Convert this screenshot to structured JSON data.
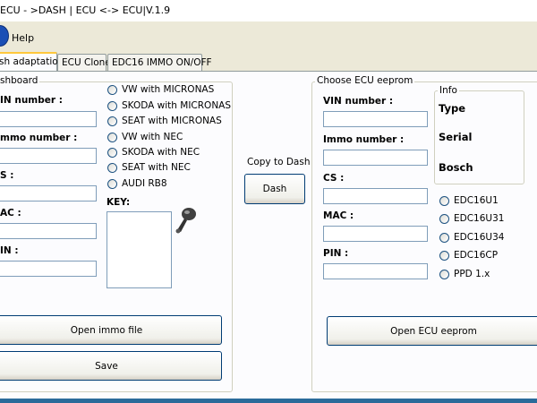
{
  "window": {
    "title": "ECU - >DASH | ECU <-> ECU|",
    "version": "V.1.9"
  },
  "menu": {
    "help_label": "Help"
  },
  "tabs": [
    {
      "label": "sh adaptation",
      "active": true
    },
    {
      "label": "ECU Clone",
      "active": false
    },
    {
      "label": "EDC16 IMMO ON/OFF",
      "active": false
    }
  ],
  "dashboard": {
    "group_title": "shboard",
    "fields": [
      {
        "label": "IN number :",
        "value": ""
      },
      {
        "label": "mmo number :",
        "value": ""
      },
      {
        "label": "S :",
        "value": ""
      },
      {
        "label": "AC :",
        "value": ""
      },
      {
        "label": "IN :",
        "value": ""
      }
    ],
    "radios": [
      "VW with MICRONAS",
      "SKODA with MICRONAS",
      "SEAT with MICRONAS",
      "VW with NEC",
      "SKODA with NEC",
      "SEAT with NEC",
      "AUDI RB8"
    ],
    "key_label": "KEY:",
    "open_button": "Open immo file",
    "save_button": "Save"
  },
  "copy": {
    "label": "Copy to Dash",
    "button": "Dash"
  },
  "ecu": {
    "group_title": "Choose ECU eeprom",
    "fields": [
      {
        "label": "VIN number :",
        "value": ""
      },
      {
        "label": "Immo number :",
        "value": ""
      },
      {
        "label": "CS :",
        "value": ""
      },
      {
        "label": "MAC :",
        "value": ""
      },
      {
        "label": "PIN :",
        "value": ""
      }
    ],
    "info": {
      "title": "Info",
      "type_label": "Type",
      "serial_label": "Serial",
      "bosch_label": "Bosch"
    },
    "radios": [
      "EDC16U1",
      "EDC16U31",
      "EDC16U34",
      "EDC16CP",
      "PPD 1.x"
    ],
    "open_button": "Open ECU eeprom"
  },
  "colors": {
    "window_bg": "#ece9d8",
    "panel_bg": "#fcfcfe",
    "input_border": "#7f9db9",
    "active_tab_accent": "#ffc83c"
  }
}
